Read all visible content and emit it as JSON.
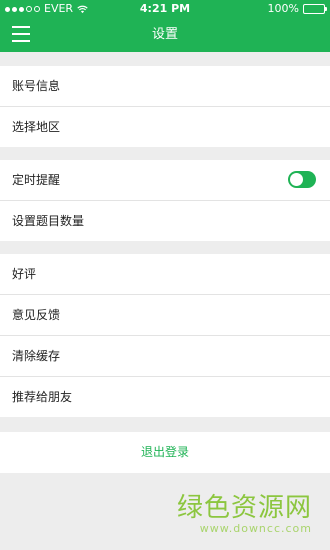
{
  "status_bar": {
    "carrier": "EVER",
    "time": "4:21 PM",
    "battery": "100%",
    "signal_strength": "3 of 5"
  },
  "header": {
    "title": "设置",
    "menu_icon": "hamburger-menu-icon"
  },
  "groups": [
    {
      "items": [
        {
          "label": "账号信息"
        },
        {
          "label": "选择地区"
        }
      ]
    },
    {
      "items": [
        {
          "label": "定时提醒",
          "toggle_on": true
        },
        {
          "label": "设置题目数量"
        }
      ]
    },
    {
      "items": [
        {
          "label": "好评"
        },
        {
          "label": "意见反馈"
        },
        {
          "label": "清除缓存"
        },
        {
          "label": "推荐给朋友"
        }
      ]
    }
  ],
  "logout_label": "退出登录",
  "watermark": {
    "main": "绿色资源网",
    "sub": "www.downcc.com"
  },
  "colors": {
    "brand_green": "#1fb355",
    "background": "#ededed",
    "watermark_green": "#8cc63f"
  }
}
